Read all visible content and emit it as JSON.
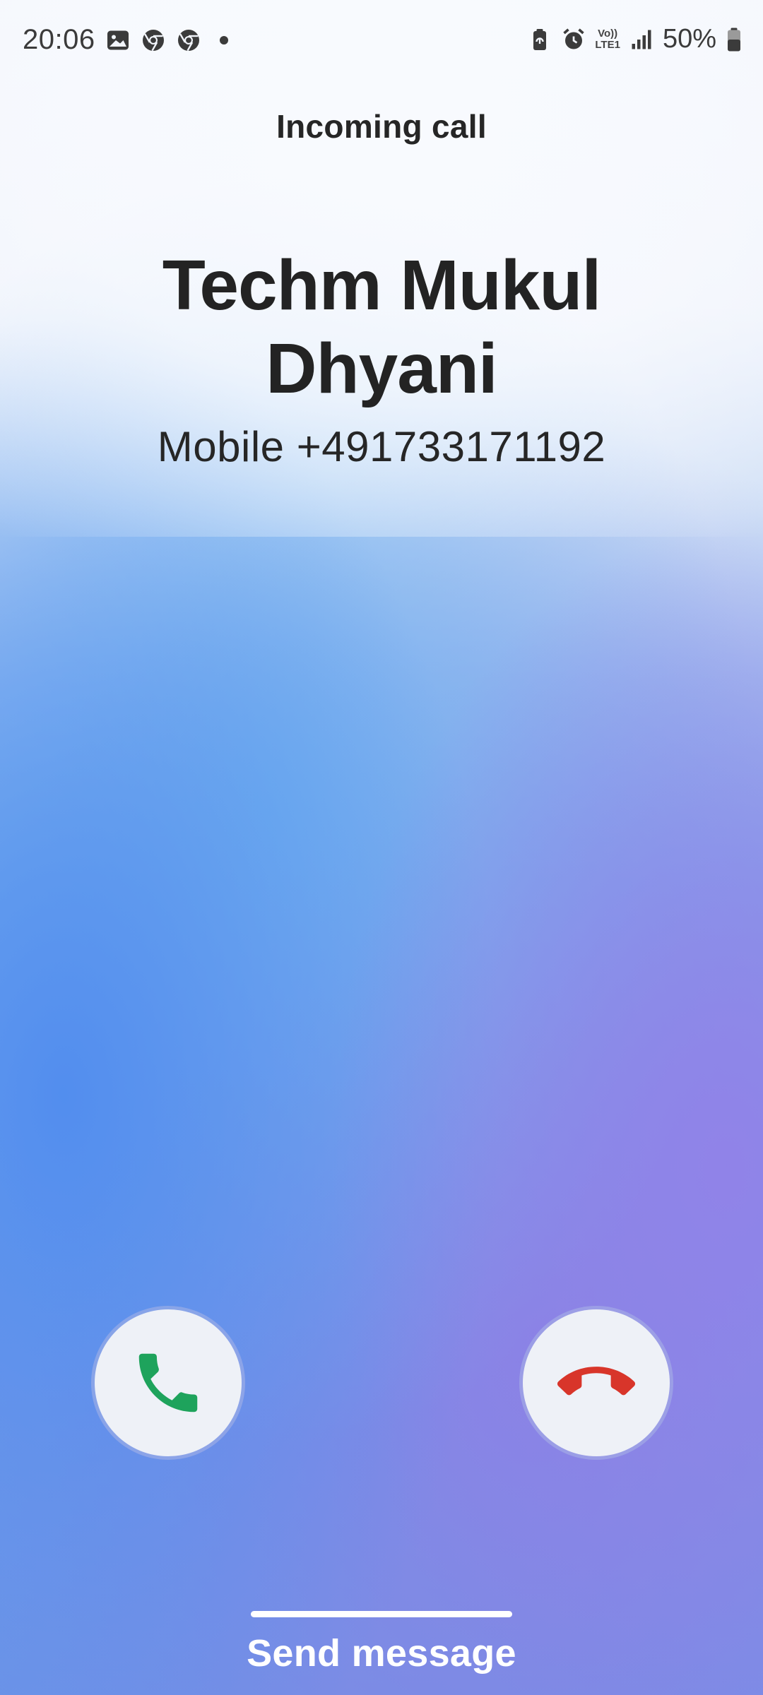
{
  "status_bar": {
    "time": "20:06",
    "battery_percent": "50%",
    "network_label_top": "Vo))",
    "network_label_bottom": "LTE1",
    "left_icons": [
      "gallery-icon",
      "chrome-icon",
      "chrome-icon",
      "dot-icon"
    ],
    "right_icons": [
      "battery-saver-icon",
      "alarm-icon",
      "volte-lte-icon",
      "signal-icon",
      "battery-icon"
    ]
  },
  "call": {
    "label": "Incoming call",
    "caller_name": "Techm Mukul Dhyani",
    "caller_number": "Mobile +491733171192"
  },
  "actions": {
    "accept_icon": "phone-accept-icon",
    "decline_icon": "phone-decline-icon",
    "accept_color": "#1ea35c",
    "decline_color": "#d8352a"
  },
  "footer": {
    "send_message": "Send message"
  }
}
